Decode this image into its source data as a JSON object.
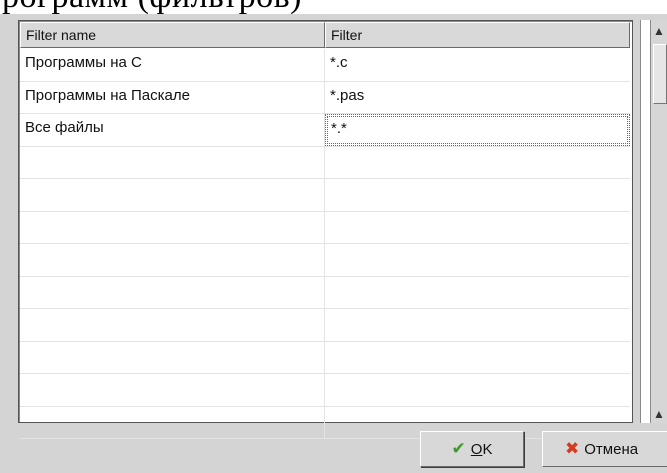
{
  "page_heading": "рограмм (фильтров)",
  "table": {
    "columns": [
      "Filter name",
      "Filter"
    ],
    "rows": [
      {
        "name": "Программы на С",
        "filter": "*.c"
      },
      {
        "name": "Программы на Паскале",
        "filter": "*.pas"
      },
      {
        "name": "Все файлы",
        "filter": "*.*"
      },
      {
        "name": "",
        "filter": ""
      },
      {
        "name": "",
        "filter": ""
      },
      {
        "name": "",
        "filter": ""
      },
      {
        "name": "",
        "filter": ""
      },
      {
        "name": "",
        "filter": ""
      },
      {
        "name": "",
        "filter": ""
      },
      {
        "name": "",
        "filter": ""
      },
      {
        "name": "",
        "filter": ""
      },
      {
        "name": "",
        "filter": ""
      }
    ],
    "editing_row": 2
  },
  "buttons": {
    "ok_label": "OK",
    "cancel_label": "Отмена"
  },
  "icons": {
    "ok": "checkmark-icon",
    "cancel": "cross-icon",
    "scroll_up": "arrow-up-icon",
    "scroll_down": "arrow-down-icon"
  },
  "colors": {
    "dialog_bg": "#d4d4d4",
    "edit_outline": "#d23a3a",
    "check_green": "#3c9a2a",
    "cross_red": "#d63b1f"
  }
}
